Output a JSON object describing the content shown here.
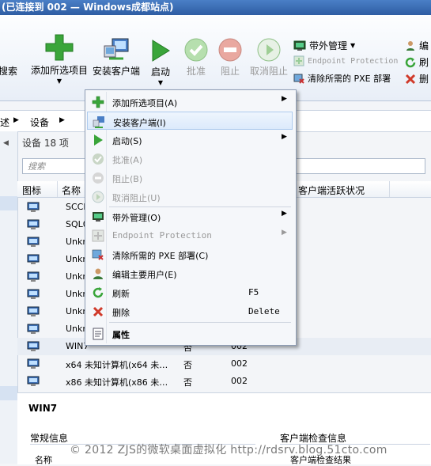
{
  "window": {
    "title": "(已连接到 002 — Windows成都站点)"
  },
  "ribbon": {
    "left_clip": "搜索",
    "add_option": "添加所选项目",
    "install_client": "安装客户端",
    "start": "启动",
    "approve": "批准",
    "block": "阻止",
    "unblock": "取消阻止",
    "oob": "带外管理",
    "endpoint": "Endpoint Protection",
    "clear_pxe": "清除所需的 PXE 部署",
    "edit_clip": "编",
    "refresh_clip": "刷",
    "delete_clip": "删"
  },
  "breadcrumb": {
    "part1": "述",
    "sep": "▶",
    "part2": "设备",
    "sep2": "▶"
  },
  "list": {
    "header": "设备 18 项",
    "search_placeholder": "搜索",
    "columns": {
      "icon": "图标",
      "name": "名称",
      "client_status": "客户端活跃状况"
    },
    "rows": [
      {
        "name": "SCCM",
        "c3": "",
        "c4": ""
      },
      {
        "name": "SQL0",
        "c3": "",
        "c4": ""
      },
      {
        "name": "Unkn",
        "c3": "",
        "c4": ""
      },
      {
        "name": "Unkn",
        "c3": "",
        "c4": ""
      },
      {
        "name": "Unkn",
        "c3": "",
        "c4": ""
      },
      {
        "name": "Unkn",
        "c3": "",
        "c4": ""
      },
      {
        "name": "Unkn",
        "c3": "",
        "c4": ""
      },
      {
        "name": "Unkn",
        "c3": "",
        "c4": ""
      },
      {
        "name": "WIN7",
        "c3": "否",
        "c4": "002"
      },
      {
        "name": "x64 未知计算机(x64 未…",
        "c3": "否",
        "c4": "002"
      },
      {
        "name": "x86 未知计算机(x86 未…",
        "c3": "否",
        "c4": "002"
      }
    ]
  },
  "context_menu": {
    "items": [
      {
        "label": "添加所选项目(A)",
        "shortcut": "",
        "arrow": "▶"
      },
      {
        "label": "安装客户端(I)",
        "shortcut": "",
        "arrow": ""
      },
      {
        "label": "启动(S)",
        "shortcut": "",
        "arrow": "▶"
      },
      {
        "label": "批准(A)",
        "shortcut": "",
        "arrow": ""
      },
      {
        "label": "阻止(B)",
        "shortcut": "",
        "arrow": ""
      },
      {
        "label": "取消阻止(U)",
        "shortcut": "",
        "arrow": ""
      },
      {
        "label": "带外管理(O)",
        "shortcut": "",
        "arrow": "▶"
      },
      {
        "label": "Endpoint Protection",
        "shortcut": "",
        "arrow": "▶"
      },
      {
        "label": "清除所需的 PXE 部署(C)",
        "shortcut": "",
        "arrow": ""
      },
      {
        "label": "编辑主要用户(E)",
        "shortcut": "",
        "arrow": ""
      },
      {
        "label": "刷新",
        "shortcut": "F5",
        "arrow": ""
      },
      {
        "label": "删除",
        "shortcut": "Delete",
        "arrow": ""
      },
      {
        "label": "属性",
        "shortcut": "",
        "arrow": ""
      }
    ]
  },
  "detail": {
    "title": "WIN7",
    "general": "常规信息",
    "client_check": "客户端检查信息",
    "name_label": "名称",
    "clip_right": "客户端检查结果"
  },
  "watermark": "© 2012 ZJS的微软桌面虚拟化   http://rdsrv.blog.51cto.com",
  "colors": {
    "accent": "#2e5da3",
    "green": "#3aa53a",
    "red": "#d03a2a"
  }
}
